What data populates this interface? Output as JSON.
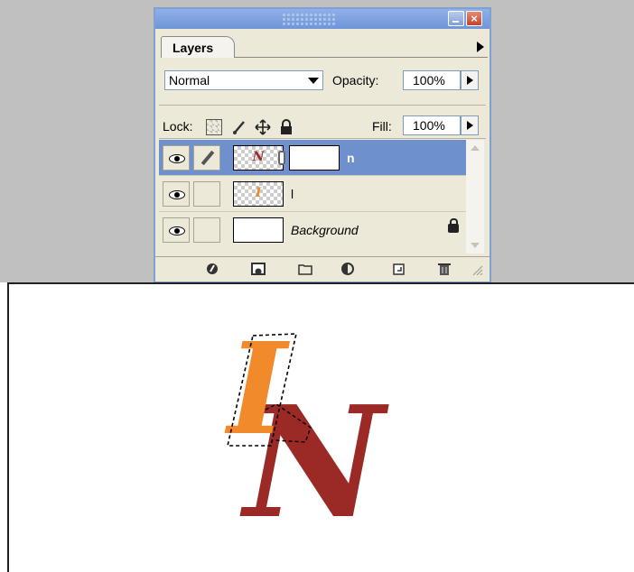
{
  "layers_panel": {
    "tab_label": "Layers",
    "blend_mode": "Normal",
    "opacity_label": "Opacity:",
    "opacity_value": "100%",
    "lock_label": "Lock:",
    "fill_label": "Fill:",
    "fill_value": "100%",
    "layers": [
      {
        "name": "n",
        "thumb_glyph": "N",
        "selected": true,
        "has_mask": true,
        "visible": true
      },
      {
        "name": "l",
        "thumb_glyph": "I",
        "selected": false,
        "has_mask": false,
        "visible": true
      },
      {
        "name": "Background",
        "selected": false,
        "locked": true,
        "visible": true
      }
    ],
    "bottom_icons": [
      "add-layer-style-icon",
      "add-mask-icon",
      "new-group-icon",
      "adjustment-layer-icon",
      "new-layer-icon",
      "trash-icon"
    ]
  },
  "canvas": {
    "letter_n": "N",
    "letter_i": "I",
    "color_n": "#9b2a26",
    "color_i": "#f08a2a",
    "selection": "marching-ants"
  },
  "colors": {
    "selected_row": "#6e91cd",
    "panel_bg": "#ece9d8",
    "titlebar": "#7a9fdf",
    "close_button": "#c4432a"
  }
}
